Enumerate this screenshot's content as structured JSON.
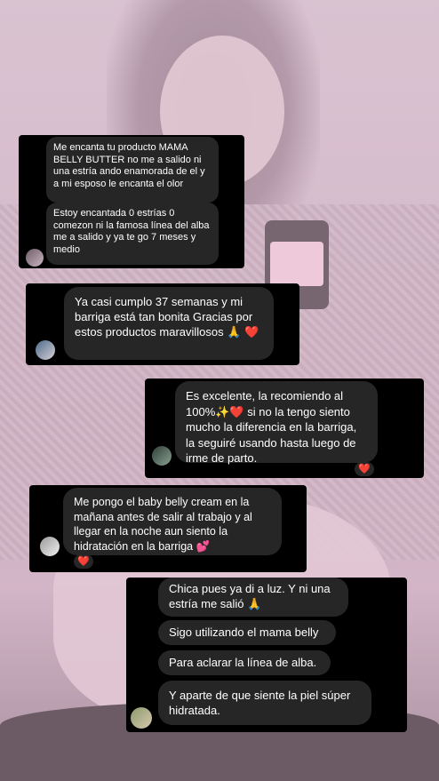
{
  "messages": [
    {
      "text": "Me encanta tu producto MAMA BELLY BUTTER no me a salido ni una estría ando enamorada de el y a mi esposo le encanta el olor"
    },
    {
      "text": "Estoy encantada 0 estrías 0 comezon ni la famosa línea del alba me a salido y ya te go 7 meses y medio"
    },
    {
      "text": "Ya casi cumplo 37 semanas y mi barriga está tan bonita Gracias por estos productos maravillosos 🙏",
      "emoji": "❤️"
    },
    {
      "text": "Es excelente, la recomiendo al 100%✨❤️ si no la tengo siento mucho la diferencia en la barriga, la seguiré usando hasta luego de irme de parto.",
      "reaction": "❤️"
    },
    {
      "text": "Me pongo el baby belly cream en la mañana antes de salir al trabajo y al llegar en la noche aun siento la hidratación en la barriga 💕",
      "reaction": "❤️"
    },
    {
      "text": "Chica pues ya di a luz. Y ni una estría me salió 🙏"
    },
    {
      "text": "Sigo utilizando el mama belly"
    },
    {
      "text": "Para aclarar la línea de alba."
    },
    {
      "text": "Y aparte de que siente la piel súper hidratada."
    }
  ],
  "colors": {
    "card_bg": "#000000",
    "bubble_bg": "#262626",
    "text": "#ffffff",
    "heart": "#e5272f"
  }
}
